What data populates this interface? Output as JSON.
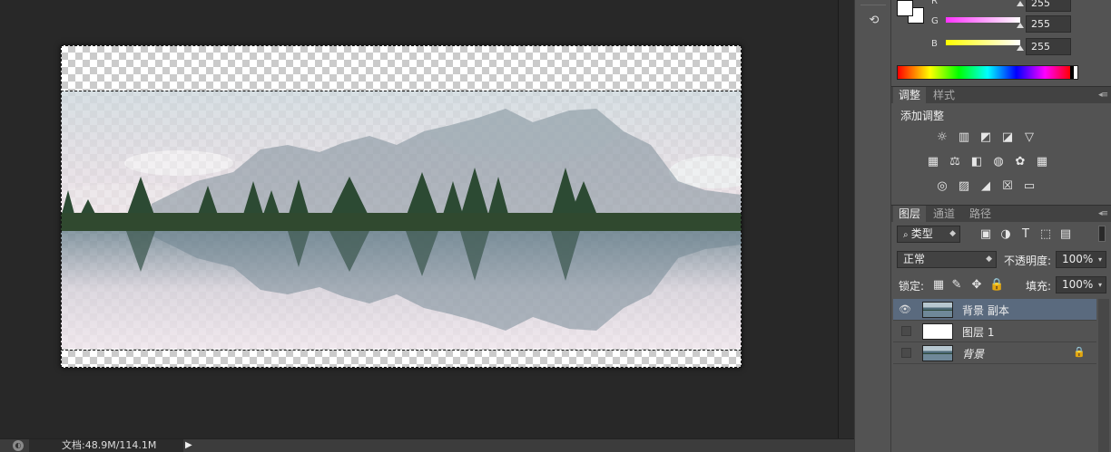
{
  "status": {
    "doc_info": "文档:48.9M/114.1M",
    "arrow": "▶"
  },
  "color_panel": {
    "channels": [
      {
        "label": "R",
        "value": "255",
        "gradient": [
          "#ff3cff",
          "#ffffff"
        ]
      },
      {
        "label": "G",
        "value": "255",
        "gradient": [
          "#ff33ff",
          "#ffffff"
        ]
      },
      {
        "label": "B",
        "value": "255",
        "gradient": [
          "#ffff00",
          "#ffffff"
        ]
      }
    ],
    "foreground": "#ffffff",
    "background": "#ffffff"
  },
  "adjustments": {
    "tabs": [
      "调整",
      "样式"
    ],
    "title": "添加调整",
    "icons": [
      [
        "brightness-icon",
        "levels-icon",
        "curves-icon",
        "exposure-icon",
        "vibrance-icon"
      ],
      [
        "hue-saturation-icon",
        "color-balance-icon",
        "black-white-icon",
        "photo-filter-icon",
        "channel-mixer-icon",
        "color-lookup-icon"
      ],
      [
        "invert-icon",
        "posterize-icon",
        "threshold-icon",
        "selective-color-icon",
        "gradient-map-icon"
      ]
    ]
  },
  "layers": {
    "tabs": [
      "图层",
      "通道",
      "路径"
    ],
    "filter_kind": "类型",
    "blend_mode": "正常",
    "opacity_label": "不透明度:",
    "opacity_value": "100%",
    "lock_label": "锁定:",
    "fill_label": "填充:",
    "fill_value": "100%",
    "items": [
      {
        "name": "背景 副本",
        "visible": true,
        "selected": true,
        "thumb": "image",
        "italic": false,
        "locked": false
      },
      {
        "name": "图层 1",
        "visible": false,
        "selected": false,
        "thumb": "white",
        "italic": false,
        "locked": false
      },
      {
        "name": "背景",
        "visible": false,
        "selected": false,
        "thumb": "image",
        "italic": true,
        "locked": true
      }
    ]
  }
}
